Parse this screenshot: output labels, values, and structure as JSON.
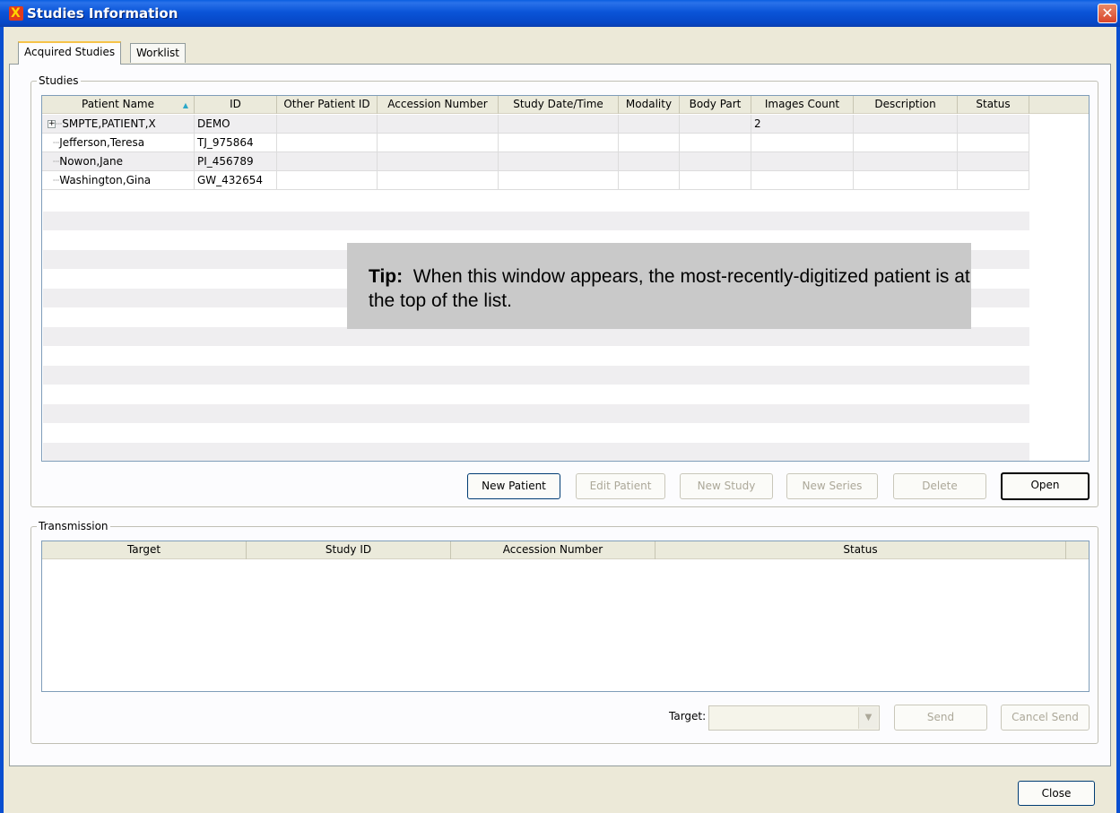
{
  "window": {
    "title": "Studies Information",
    "close_glyph": "✕"
  },
  "tabs": [
    {
      "label": "Acquired Studies"
    },
    {
      "label": "Worklist"
    }
  ],
  "studies": {
    "group_label": "Studies",
    "columns": [
      "Patient Name",
      "ID",
      "Other Patient ID",
      "Accession Number",
      "Study Date/Time",
      "Modality",
      "Body Part",
      "Images Count",
      "Description",
      "Status"
    ],
    "sort_icon": "sort-ascending-icon",
    "rows": [
      {
        "patient_name": "SMPTE,PATIENT,X",
        "id": "DEMO",
        "other_id": "",
        "accession": "",
        "study_date": "",
        "modality": "",
        "body_part": "",
        "images_count": "2",
        "description": "",
        "status": "",
        "expandable": true
      },
      {
        "patient_name": "Jefferson,Teresa",
        "id": "TJ_975864",
        "other_id": "",
        "accession": "",
        "study_date": "",
        "modality": "",
        "body_part": "",
        "images_count": "",
        "description": "",
        "status": "",
        "expandable": false
      },
      {
        "patient_name": "Nowon,Jane",
        "id": "PI_456789",
        "other_id": "",
        "accession": "",
        "study_date": "",
        "modality": "",
        "body_part": "",
        "images_count": "",
        "description": "",
        "status": "",
        "expandable": false
      },
      {
        "patient_name": "Washington,Gina",
        "id": "GW_432654",
        "other_id": "",
        "accession": "",
        "study_date": "",
        "modality": "",
        "body_part": "",
        "images_count": "",
        "description": "",
        "status": "",
        "expandable": false
      }
    ],
    "buttons": {
      "new_patient": "New Patient",
      "edit_patient": "Edit Patient",
      "new_study": "New Study",
      "new_series": "New Series",
      "delete": "Delete",
      "open": "Open"
    }
  },
  "tip": {
    "label": "Tip:",
    "text": "When this window appears, the most-recently-digitized patient is at the top of the list."
  },
  "transmission": {
    "group_label": "Transmission",
    "columns": [
      "Target",
      "Study ID",
      "Accession Number",
      "Status"
    ],
    "target_label": "Target:",
    "target_value": "",
    "buttons": {
      "send": "Send",
      "cancel_send": "Cancel Send"
    }
  },
  "footer": {
    "close": "Close"
  }
}
